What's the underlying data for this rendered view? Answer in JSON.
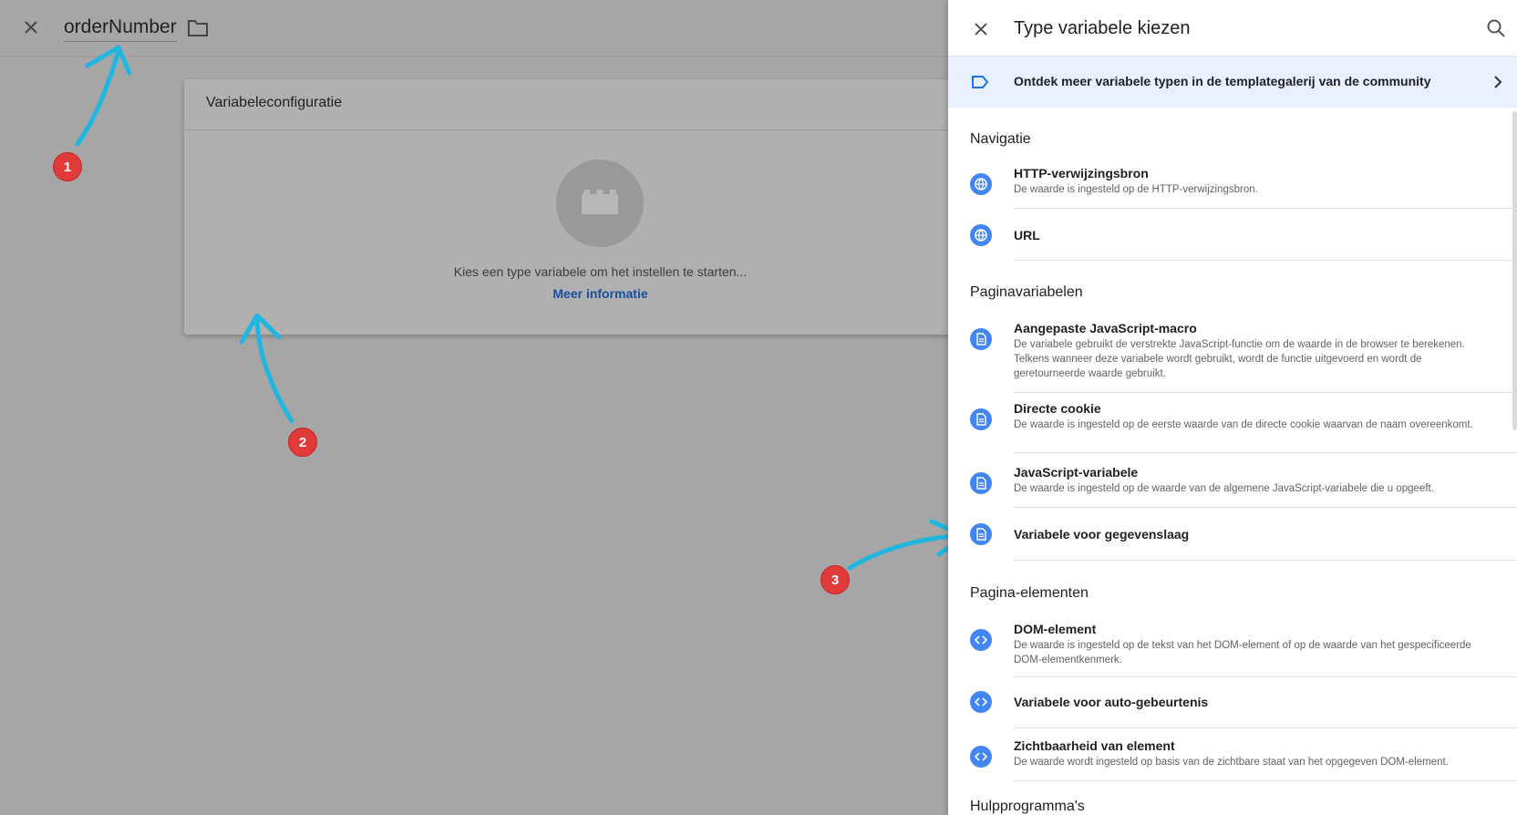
{
  "editor": {
    "variable_name": "orderNumber",
    "config_card": {
      "title": "Variabeleconfiguratie",
      "hint": "Kies een type variabele om het instellen te starten...",
      "link": "Meer informatie"
    }
  },
  "annotations": {
    "badge_1": "1",
    "badge_2": "2",
    "badge_3": "3",
    "arrow_color": "#1fb6e0",
    "badge_color": "#e03a3a"
  },
  "panel": {
    "title": "Type variabele kiezen",
    "gallery_banner": "Ontdek meer variabele typen in de templategalerij van de community",
    "sections": [
      {
        "title": "Navigatie",
        "items": [
          {
            "title": "HTTP-verwijzingsbron",
            "desc": "De waarde is ingesteld op de HTTP-verwijzingsbron.",
            "icon": "globe-icon"
          },
          {
            "title": "URL",
            "desc": "",
            "icon": "globe-icon"
          }
        ]
      },
      {
        "title": "Paginavariabelen",
        "items": [
          {
            "title": "Aangepaste JavaScript-macro",
            "desc": "De variabele gebruikt de verstrekte JavaScript-functie om de waarde in de browser te berekenen. Telkens wanneer deze variabele wordt gebruikt, wordt de functie uitgevoerd en wordt de geretourneerde waarde gebruikt.",
            "icon": "document-icon"
          },
          {
            "title": "Directe cookie",
            "desc": "De waarde is ingesteld op de eerste waarde van de directe cookie waarvan de naam overeenkomt.",
            "icon": "document-icon"
          },
          {
            "title": "JavaScript-variabele",
            "desc": "De waarde is ingesteld op de waarde van de algemene JavaScript-variabele die u opgeeft.",
            "icon": "document-icon"
          },
          {
            "title": "Variabele voor gegevenslaag",
            "desc": "",
            "icon": "document-icon"
          }
        ]
      },
      {
        "title": "Pagina-elementen",
        "items": [
          {
            "title": "DOM-element",
            "desc": "De waarde is ingesteld op de tekst van het DOM-element of op de waarde van het gespecificeerde DOM-elementkenmerk.",
            "icon": "code-icon"
          },
          {
            "title": "Variabele voor auto-gebeurtenis",
            "desc": "",
            "icon": "code-icon"
          },
          {
            "title": "Zichtbaarheid van element",
            "desc": "De waarde wordt ingesteld op basis van de zichtbare staat van het opgegeven DOM-element.",
            "icon": "code-icon"
          }
        ]
      },
      {
        "title": "Hulpprogramma's",
        "items": []
      }
    ]
  }
}
